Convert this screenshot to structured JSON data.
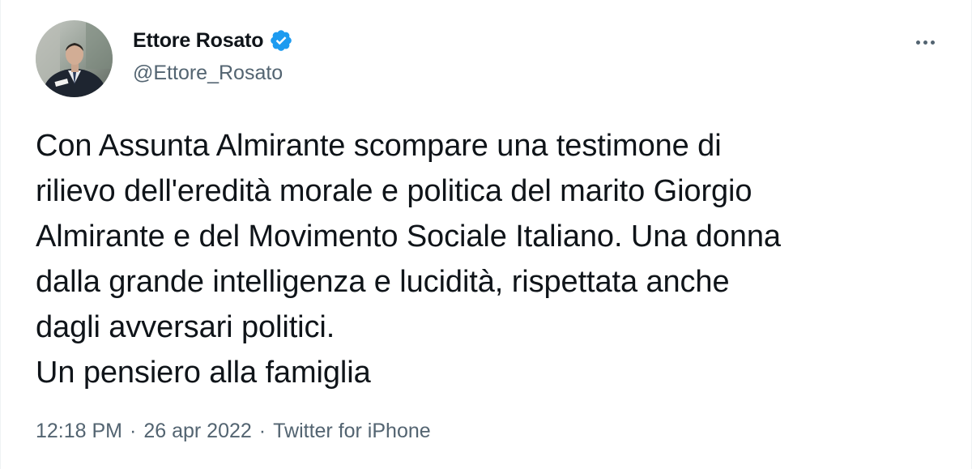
{
  "author": {
    "name": "Ettore Rosato",
    "handle": "@Ettore_Rosato",
    "verified": true
  },
  "tweet": {
    "text": "Con Assunta Almirante scompare una testimone di\nrilievo dell'eredità morale e politica del marito Giorgio\nAlmirante e del Movimento Sociale Italiano. Una donna\ndalla grande intelligenza e lucidità, rispettata anche\ndagli avversari politici.\nUn pensiero alla famiglia"
  },
  "meta": {
    "time": "12:18 PM",
    "separator": "·",
    "date": "26 apr 2022",
    "source": "Twitter for iPhone"
  },
  "icons": {
    "more": "more-options-icon",
    "verified": "verified-badge-icon"
  },
  "colors": {
    "verified_blue": "#1d9bf0",
    "text_primary": "#0f1419",
    "text_secondary": "#536471"
  }
}
